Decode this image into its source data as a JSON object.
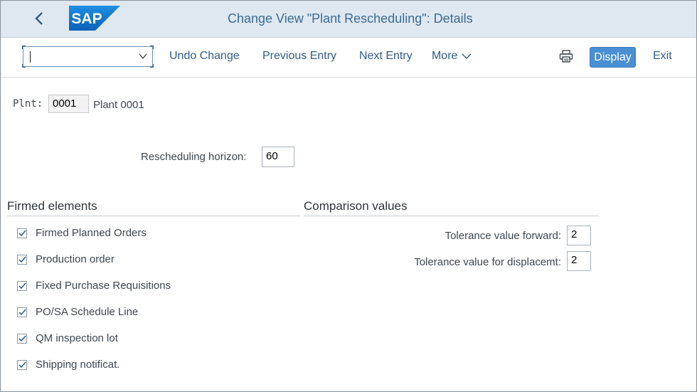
{
  "header": {
    "back_icon": "chevron-left-icon",
    "logo_text": "SAP",
    "title": "Change View \"Plant Rescheduling\": Details"
  },
  "toolbar": {
    "command_field": {
      "value": "",
      "placeholder": ""
    },
    "undo_change": "Undo Change",
    "previous_entry": "Previous Entry",
    "next_entry": "Next Entry",
    "more": "More",
    "print_icon": "printer-icon",
    "display": "Display",
    "exit": "Exit"
  },
  "plant": {
    "label": "Plnt:",
    "value": "0001",
    "description": "Plant 0001"
  },
  "rescheduling": {
    "label": "Rescheduling horizon:",
    "value": "60"
  },
  "firmed_elements": {
    "title": "Firmed elements",
    "items": [
      {
        "label": "Firmed Planned Orders",
        "checked": true
      },
      {
        "label": "Production order",
        "checked": true
      },
      {
        "label": "Fixed Purchase Requisitions",
        "checked": true
      },
      {
        "label": "PO/SA Schedule Line",
        "checked": true
      },
      {
        "label": "QM inspection lot",
        "checked": true
      },
      {
        "label": "Shipping notificat.",
        "checked": true
      }
    ]
  },
  "comparison_values": {
    "title": "Comparison values",
    "tolerance_forward": {
      "label": "Tolerance value forward:",
      "value": "2"
    },
    "tolerance_displacement": {
      "label": "Tolerance value for displacemt:",
      "value": "2"
    }
  },
  "colors": {
    "title_bar_bg": "#dfe8f1",
    "title_text": "#3c6a94",
    "link_text": "#2f5d8a",
    "sap_logo_blue": "#1a7ad4",
    "display_button_bg": "#4b8fd3"
  }
}
